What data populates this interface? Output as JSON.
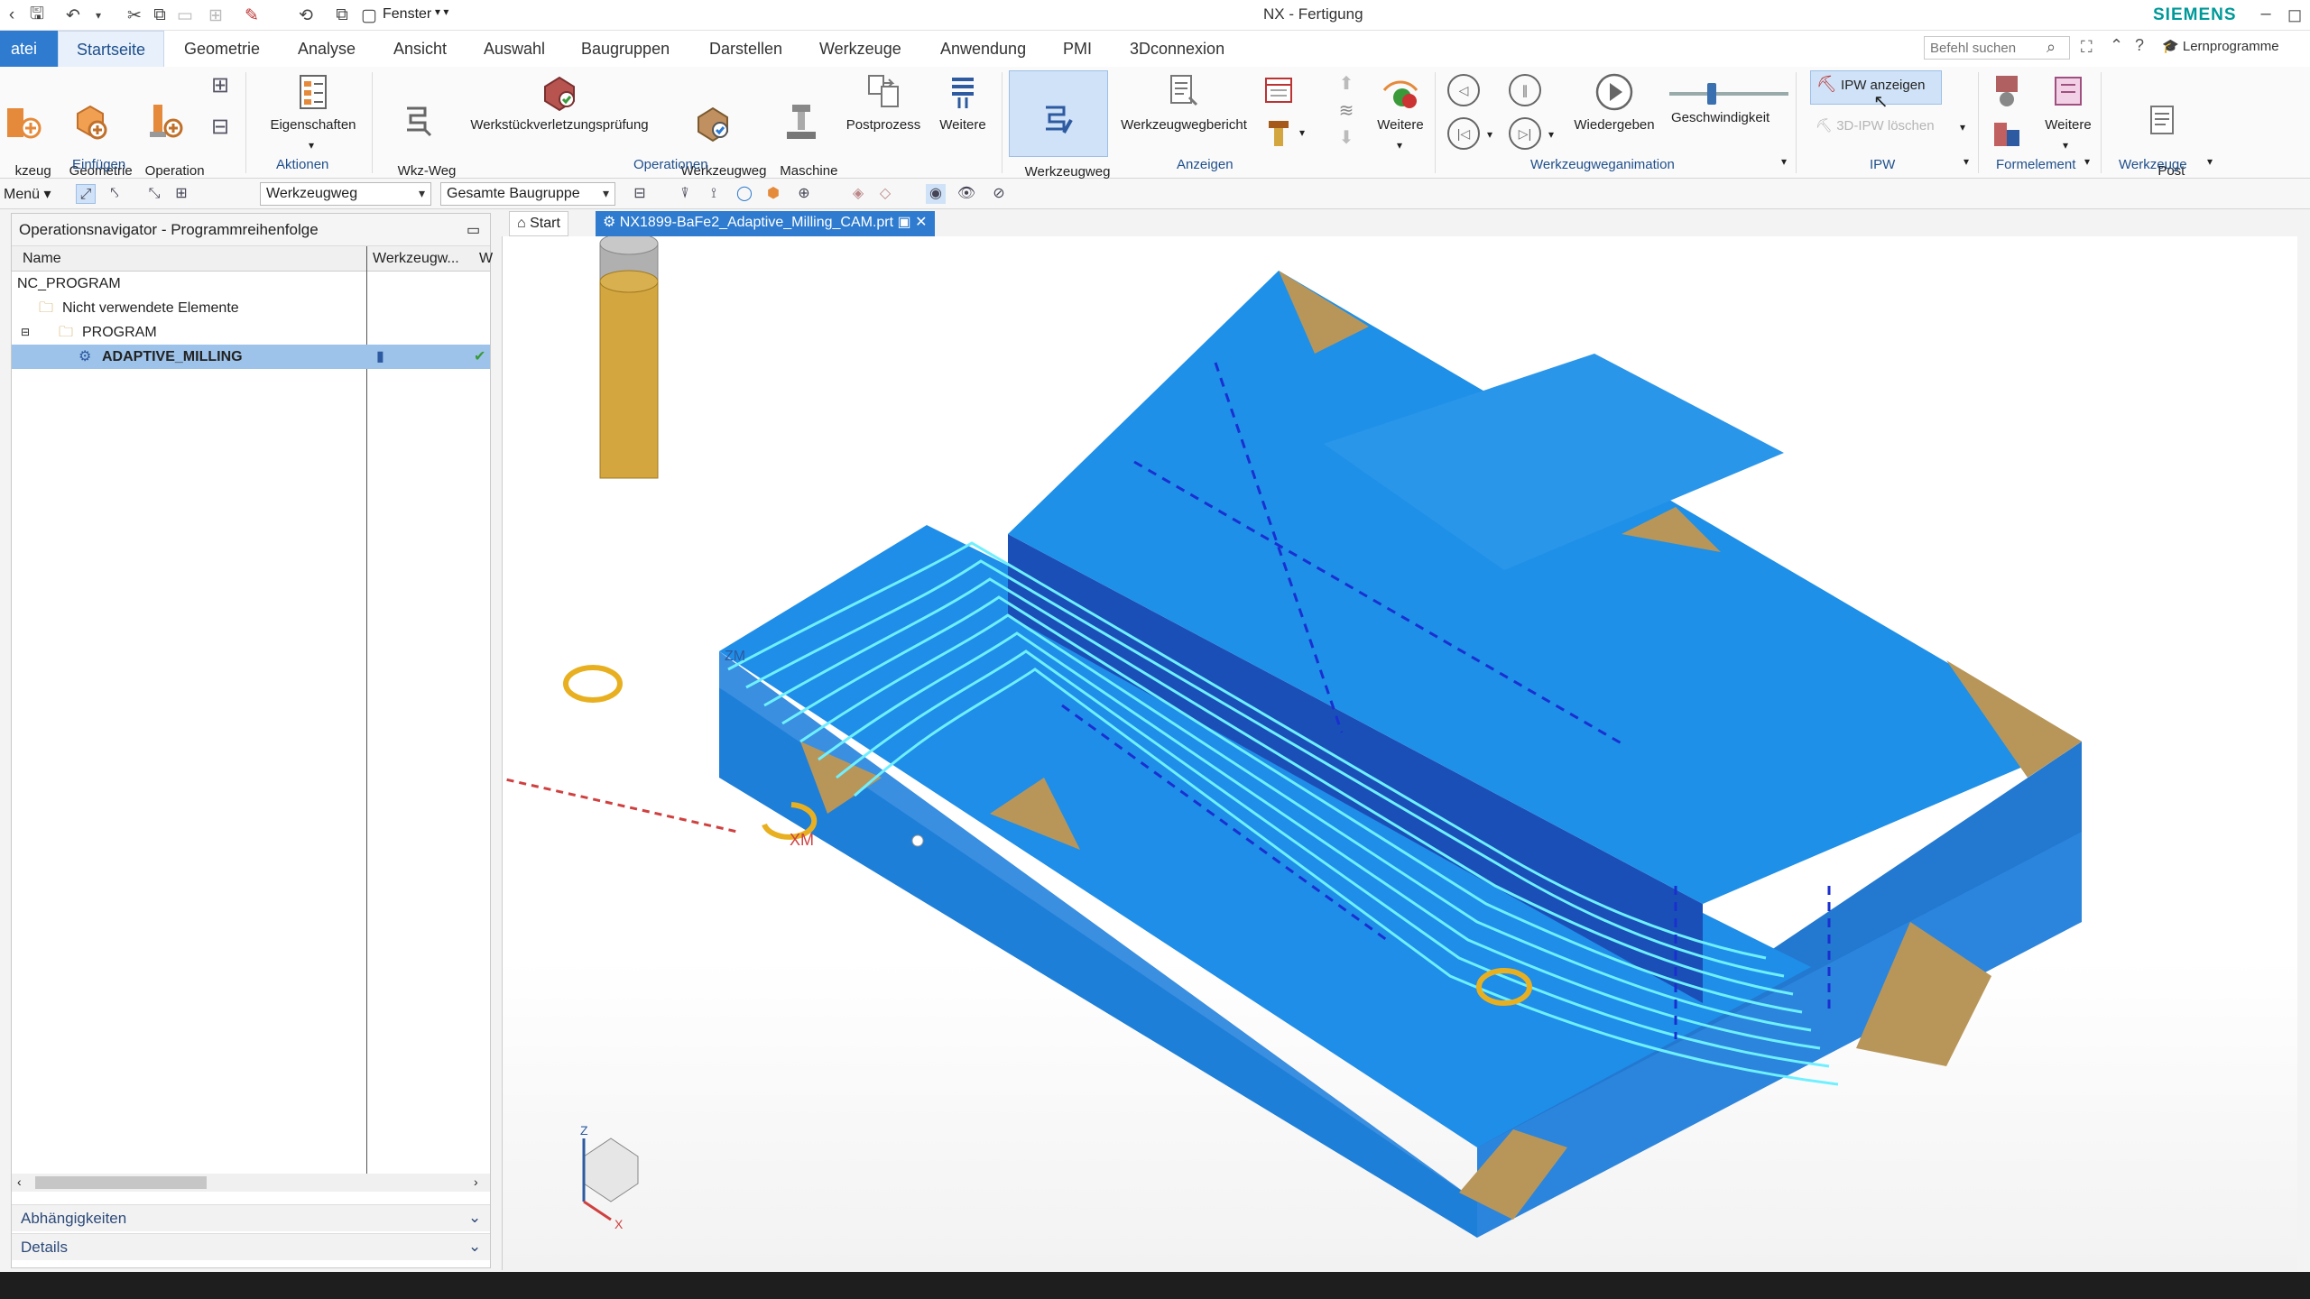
{
  "titlebar": {
    "fenster_label": "Fenster",
    "title": "NX - Fertigung",
    "brand": "SIEMENS",
    "icons": [
      "save-icon",
      "undo-icon",
      "copy-icon",
      "paste-icon",
      "cut-icon",
      "paint-icon",
      "window-icon"
    ]
  },
  "menu": {
    "tabs": [
      "atei",
      "Startseite",
      "Geometrie",
      "Analyse",
      "Ansicht",
      "Auswahl",
      "Baugruppen",
      "Darstellen",
      "Werkzeuge",
      "Anwendung",
      "PMI",
      "3Dconnexion"
    ],
    "search_placeholder": "Befehl suchen",
    "lernprogramme": "Lernprogramme"
  },
  "ribbon": {
    "buttons": {
      "werkzeug": "kzeug\nzeugen",
      "geometrie": "Geometrie\nerzeugen",
      "operation": "Operation\nerzeugen",
      "eigenschaften": "Eigenschaften",
      "wkzweg": "Wkz-Weg\nerzeugen",
      "werkstueck": "Werkstückverletzungsprüfung",
      "werkzeugweg_pruefen": "Werkzeugweg\nüberprüfen",
      "maschine": "Maschine\nsimulieren",
      "postprozess": "Postprozess",
      "weitere1": "Weitere",
      "werkzeugweg_anzeigen": "Werkzeugweg\nanzeigen",
      "werkzeugwegbericht": "Werkzeugwegbericht",
      "weitere2": "Weitere",
      "wiedergeben": "Wiedergeben",
      "geschwindigkeit": "Geschwindigkeit",
      "ipw_anzeigen": "IPW anzeigen",
      "ipw_loeschen": "3D-IPW löschen",
      "weitere3": "Weitere",
      "post_configurator": "Post\nConfigurator"
    },
    "groups": [
      "Einfügen",
      "Aktionen",
      "Operationen",
      "Anzeigen",
      "Werkzeugweganimation",
      "IPW",
      "Formelement",
      "Werkzeuge"
    ]
  },
  "toolbar2": {
    "menu_label": "Menü",
    "filter1": "Werkzeugweg",
    "filter2": "Gesamte Baugruppe"
  },
  "navigator": {
    "title": "Operationsnavigator - Programmreihenfolge",
    "columns": [
      "Name",
      "Werkzeugw...",
      "W"
    ],
    "rows": [
      {
        "name": "NC_PROGRAM"
      },
      {
        "name": "Nicht verwendete Elemente"
      },
      {
        "name": "PROGRAM"
      },
      {
        "name": "ADAPTIVE_MILLING"
      }
    ],
    "sections": [
      "Abhängigkeiten",
      "Details"
    ]
  },
  "viewport": {
    "tabs": [
      "Start",
      "NX1899-BaFe2_Adaptive_Milling_CAM.prt"
    ],
    "axis_labels": {
      "xm": "XM",
      "z": "Z",
      "x": "X",
      "zm": "ZM"
    },
    "colors": {
      "part_blue": "#1e90e8",
      "wall_blue": "#1b56c8",
      "stock_gold": "#b8965a",
      "toolpath": "#6ff0ff",
      "tool": "#d4a640"
    }
  }
}
